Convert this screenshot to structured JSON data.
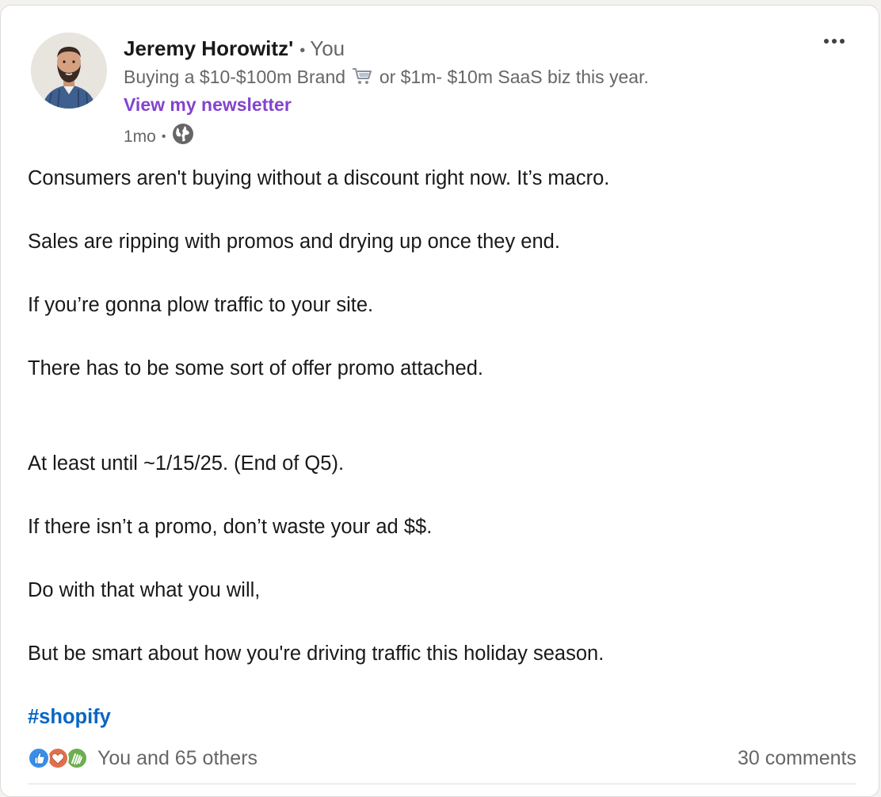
{
  "post": {
    "author": {
      "name": "Jeremy Horowitz'",
      "separator": "•",
      "relation": "You",
      "headline_before": "Buying a $10-$100m Brand",
      "headline_after": "or $1m- $10m SaaS biz this year.",
      "newsletter_link": "View my newsletter"
    },
    "meta": {
      "time": "1mo",
      "separator": "•",
      "visibility_icon": "globe-icon"
    },
    "body": [
      "Consumers aren't buying without a discount right now. It’s macro.",
      "Sales are ripping with promos and drying up once they end.",
      "If you’re gonna plow traffic to your site.",
      "There has to be some sort of offer promo attached.",
      "At least until ~1/15/25. (End of Q5).",
      "If there isn’t a promo, don’t waste your ad $$.",
      "Do with that what you will,",
      "But be smart about how you're driving traffic this holiday season."
    ],
    "hashtag": "#shopify",
    "social": {
      "reactions_text": "You and 65 others",
      "reaction_icons": [
        "like-icon",
        "love-icon",
        "celebrate-icon"
      ],
      "comments": "30 comments"
    }
  },
  "colors": {
    "newsletter": "#8344cc",
    "hashtag": "#0a66c2",
    "like": "#378fe9",
    "love": "#df704d",
    "celebrate": "#6dae4f"
  }
}
